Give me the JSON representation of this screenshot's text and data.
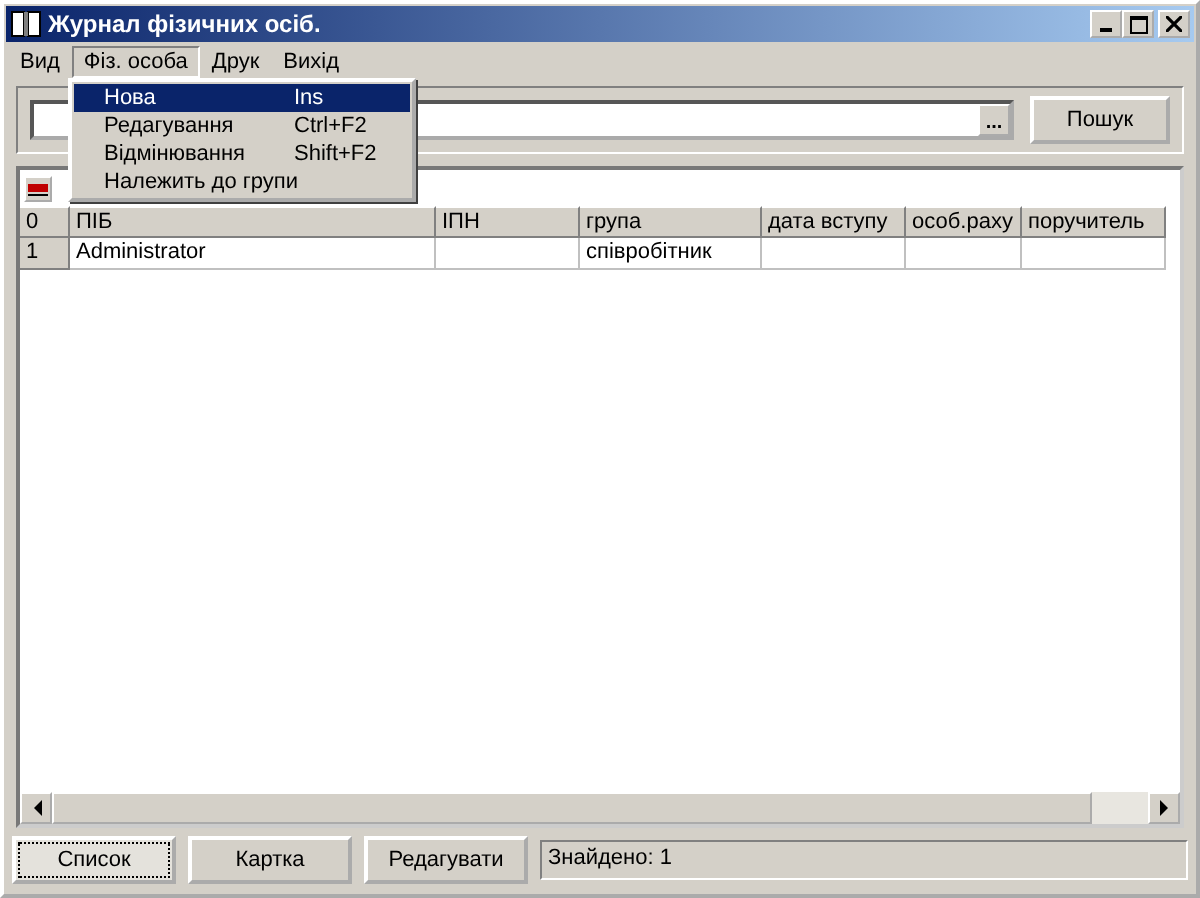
{
  "window": {
    "title": "Журнал фізичних осіб."
  },
  "menu": [
    {
      "label": "Вид",
      "selected": false
    },
    {
      "label": "Фіз. особа",
      "selected": true
    },
    {
      "label": "Друк",
      "selected": false
    },
    {
      "label": "Вихід",
      "selected": false
    }
  ],
  "dropdown": [
    {
      "label": "Нова",
      "shortcut": "Ins",
      "selected": true
    },
    {
      "label": "Редагування",
      "shortcut": "Ctrl+F2",
      "selected": false
    },
    {
      "label": "Відмінювання",
      "shortcut": "Shift+F2",
      "selected": false
    },
    {
      "label": "Належить до групи",
      "selected": false
    }
  ],
  "search": {
    "browse": "...",
    "button": "Пошук"
  },
  "table": {
    "columns": [
      "0",
      "ПІБ",
      "ІПН",
      "група",
      "дата вступу",
      "особ.раху",
      "поручитель"
    ],
    "rows": [
      [
        "1",
        "Administrator",
        "",
        "співробітник",
        "",
        "",
        ""
      ]
    ]
  },
  "buttons": [
    {
      "label": "Список",
      "selected": true
    },
    {
      "label": "Картка",
      "selected": false
    },
    {
      "label": "Редагувати",
      "selected": false
    }
  ],
  "status": "Знайдено: 1"
}
